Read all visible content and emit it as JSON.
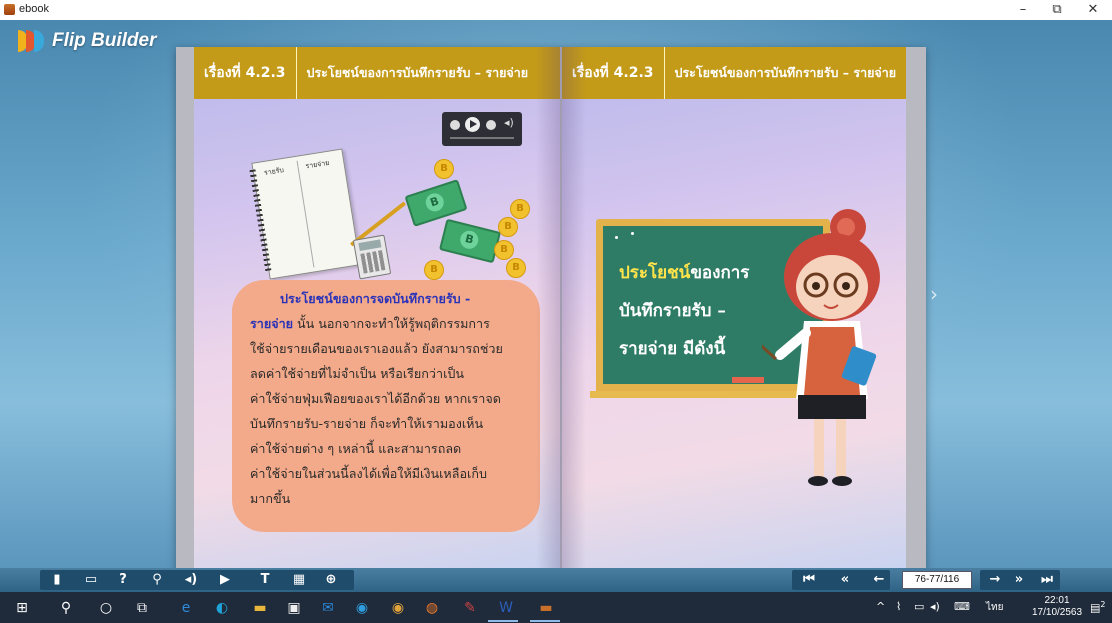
{
  "window": {
    "title": "ebook",
    "controls": {
      "minimize": "–",
      "maximize": "⧉",
      "close": "✕"
    }
  },
  "logo": {
    "text": "Flip Builder"
  },
  "book": {
    "left_page": {
      "header_number": "เรื่องที่ 4.2.3",
      "header_topic": "ประโยชน์ของการบันทึกรายรับ – รายจ่าย",
      "notebook_labels": {
        "income": "รายรับ",
        "expense": "รายจ่าย"
      },
      "bubble": {
        "line1": "ประโยชน์ของการจดบันทึกรายรับ -",
        "line2_hl": "รายจ่าย",
        "line2_rest": " นั้น นอกจากจะทำให้รู้พฤติกรรมการ",
        "line3": "ใช้จ่ายรายเดือนของเราเองแล้ว ยังสามารถช่วย",
        "line4": "ลดค่าใช้จ่ายที่ไม่จำเป็น หรือเรียกว่าเป็น",
        "line5": "ค่าใช้จ่ายฟุ่มเฟือยของเราได้อีกด้วย หากเราจด",
        "line6": "บันทึกรายรับ-รายจ่าย ก็จะทำให้เรามองเห็น",
        "line7": "ค่าใช้จ่ายต่าง ๆ เหล่านี้ และสามารถลด",
        "line8": "ค่าใช้จ่ายในส่วนนี้ลงได้เพื่อให้มีเงินเหลือเก็บ",
        "line9": "มากขึ้น"
      }
    },
    "right_page": {
      "header_number": "เรื่องที่ 4.2.3",
      "header_topic": "ประโยชน์ของการบันทึกรายรับ – รายจ่าย",
      "board": {
        "line1_hl": "ประโยชน์",
        "line1_rest": "ของการ",
        "line2": "บันทึกรายรับ –",
        "line3": "รายจ่าย มีดังนี้"
      }
    }
  },
  "toolbar": {
    "page_indicator": "76-77/116"
  },
  "taskbar": {
    "language": "ไทย",
    "time": "22:01",
    "date": "17/10/2563",
    "notifications": "2"
  },
  "colors": {
    "header_gold": "#c49a19",
    "bubble_peach": "#f3aa8b",
    "board_green": "#2f7c66",
    "highlight_blue": "#2a33b8",
    "highlight_yellow": "#ffe34a"
  }
}
